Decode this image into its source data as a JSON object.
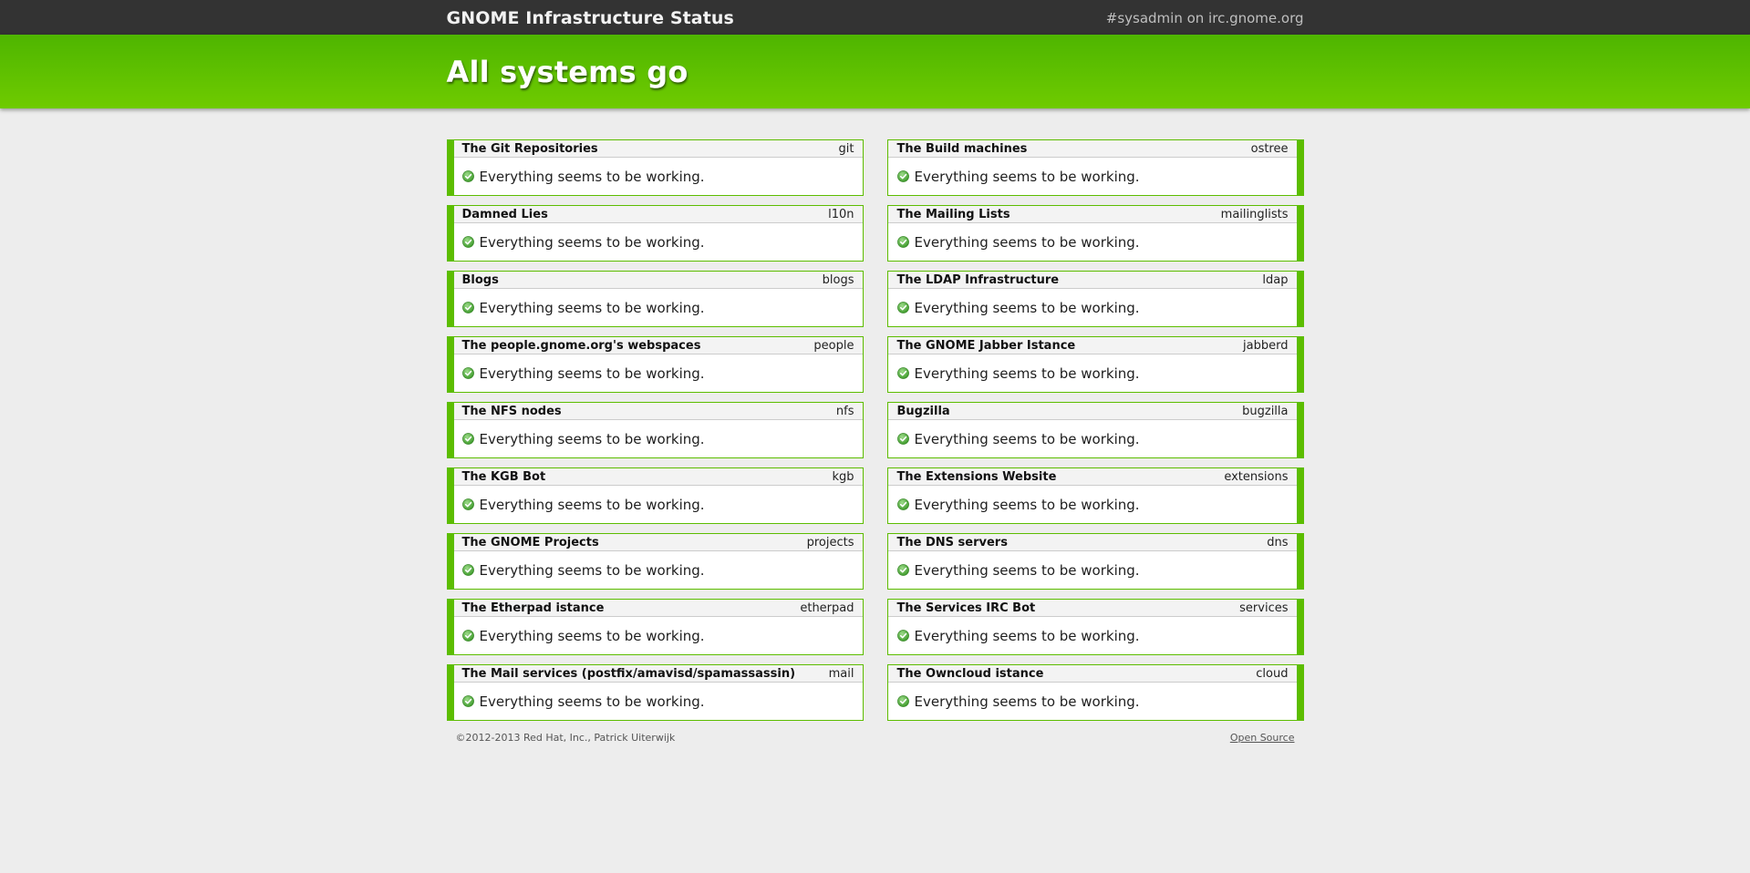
{
  "header": {
    "site_title": "GNOME Infrastructure Status",
    "irc_link": "#sysadmin on irc.gnome.org"
  },
  "banner": {
    "status_heading": "All systems go"
  },
  "colors": {
    "ok_green": "#5cbd00",
    "topbar": "#333333",
    "banner_top": "#4eb500",
    "banner_bottom": "#6fcb00"
  },
  "services": [
    {
      "title": "The Git Repositories",
      "tag": "git",
      "status_icon": "check-circle-icon",
      "message": "Everything seems to be working."
    },
    {
      "title": "The Build machines",
      "tag": "ostree",
      "status_icon": "check-circle-icon",
      "message": "Everything seems to be working."
    },
    {
      "title": "Damned Lies",
      "tag": "l10n",
      "status_icon": "check-circle-icon",
      "message": "Everything seems to be working."
    },
    {
      "title": "The Mailing Lists",
      "tag": "mailinglists",
      "status_icon": "check-circle-icon",
      "message": "Everything seems to be working."
    },
    {
      "title": "Blogs",
      "tag": "blogs",
      "status_icon": "check-circle-icon",
      "message": "Everything seems to be working."
    },
    {
      "title": "The LDAP Infrastructure",
      "tag": "ldap",
      "status_icon": "check-circle-icon",
      "message": "Everything seems to be working."
    },
    {
      "title": "The people.gnome.org's webspaces",
      "tag": "people",
      "status_icon": "check-circle-icon",
      "message": "Everything seems to be working."
    },
    {
      "title": "The GNOME Jabber Istance",
      "tag": "jabberd",
      "status_icon": "check-circle-icon",
      "message": "Everything seems to be working."
    },
    {
      "title": "The NFS nodes",
      "tag": "nfs",
      "status_icon": "check-circle-icon",
      "message": "Everything seems to be working."
    },
    {
      "title": "Bugzilla",
      "tag": "bugzilla",
      "status_icon": "check-circle-icon",
      "message": "Everything seems to be working."
    },
    {
      "title": "The KGB Bot",
      "tag": "kgb",
      "status_icon": "check-circle-icon",
      "message": "Everything seems to be working."
    },
    {
      "title": "The Extensions Website",
      "tag": "extensions",
      "status_icon": "check-circle-icon",
      "message": "Everything seems to be working."
    },
    {
      "title": "The GNOME Projects",
      "tag": "projects",
      "status_icon": "check-circle-icon",
      "message": "Everything seems to be working."
    },
    {
      "title": "The DNS servers",
      "tag": "dns",
      "status_icon": "check-circle-icon",
      "message": "Everything seems to be working."
    },
    {
      "title": "The Etherpad istance",
      "tag": "etherpad",
      "status_icon": "check-circle-icon",
      "message": "Everything seems to be working."
    },
    {
      "title": "The Services IRC Bot",
      "tag": "services",
      "status_icon": "check-circle-icon",
      "message": "Everything seems to be working."
    },
    {
      "title": "The Mail services (postfix/amavisd/spamassassin)",
      "tag": "mail",
      "status_icon": "check-circle-icon",
      "message": "Everything seems to be working."
    },
    {
      "title": "The Owncloud istance",
      "tag": "cloud",
      "status_icon": "check-circle-icon",
      "message": "Everything seems to be working."
    }
  ],
  "footer": {
    "copyright": "©2012-2013 Red Hat, Inc., Patrick Uiterwijk",
    "open_source_link": "Open Source"
  }
}
